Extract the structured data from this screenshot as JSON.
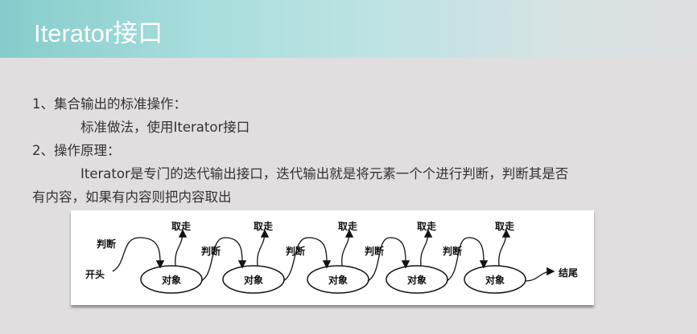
{
  "slide": {
    "title": "Iterator接口",
    "lines": [
      "1、集合输出的标准操作：",
      "标准做法，使用Iterator接口",
      "2、操作原理：",
      "Iterator是专门的迭代输出接口，迭代输出就是将元素一个个进行判断，判断其是否",
      "有内容，如果有内容则把内容取出"
    ]
  },
  "diagram": {
    "start_label": "开头",
    "end_label": "结尾",
    "node_label": "对象",
    "take_label": "取走",
    "judge_label": "判断",
    "node_count": 5
  }
}
